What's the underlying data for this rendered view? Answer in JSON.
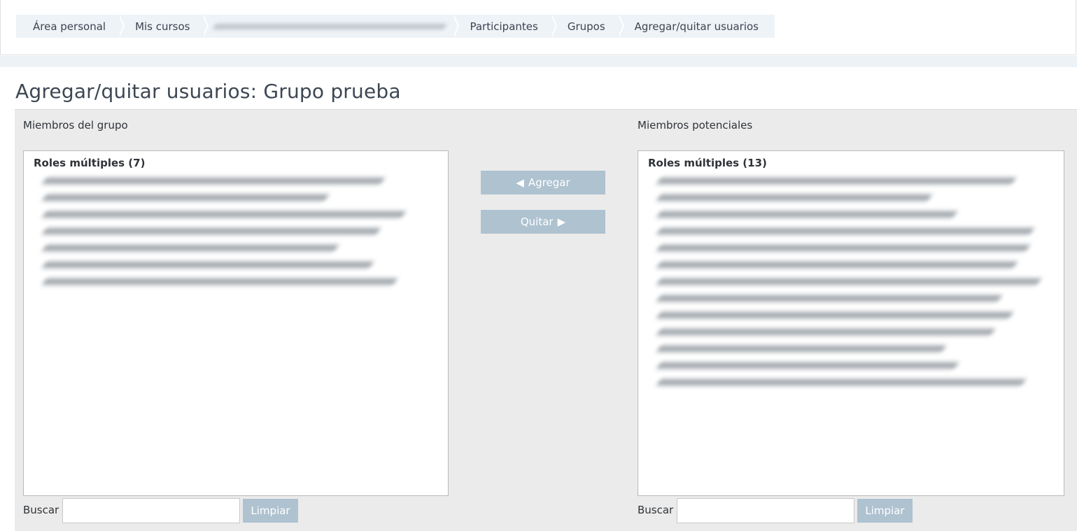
{
  "breadcrumb": {
    "items": [
      {
        "label": "Área personal"
      },
      {
        "label": "Mis cursos"
      },
      {
        "label": ""
      },
      {
        "label": "Participantes"
      },
      {
        "label": "Grupos"
      },
      {
        "label": "Agregar/quitar usuarios"
      }
    ]
  },
  "page": {
    "title": "Agregar/quitar usuarios: Grupo prueba"
  },
  "members": {
    "label": "Miembros del grupo",
    "group_label": "Roles múltiples (7)",
    "search_label": "Buscar",
    "search_value": "",
    "clear_label": "Limpiar"
  },
  "potential": {
    "label": "Miembros potenciales",
    "group_label": "Roles múltiples (13)",
    "search_label": "Buscar",
    "search_value": "",
    "clear_label": "Limpiar"
  },
  "actions": {
    "add_label": "Agregar",
    "add_icon": "left-triangle-icon",
    "remove_label": "Quitar",
    "remove_icon": "right-triangle-icon"
  },
  "colors": {
    "button_bg": "#aec2d0",
    "panel_bg": "#ebebeb",
    "breadcrumb_bg": "#eef3f7"
  }
}
